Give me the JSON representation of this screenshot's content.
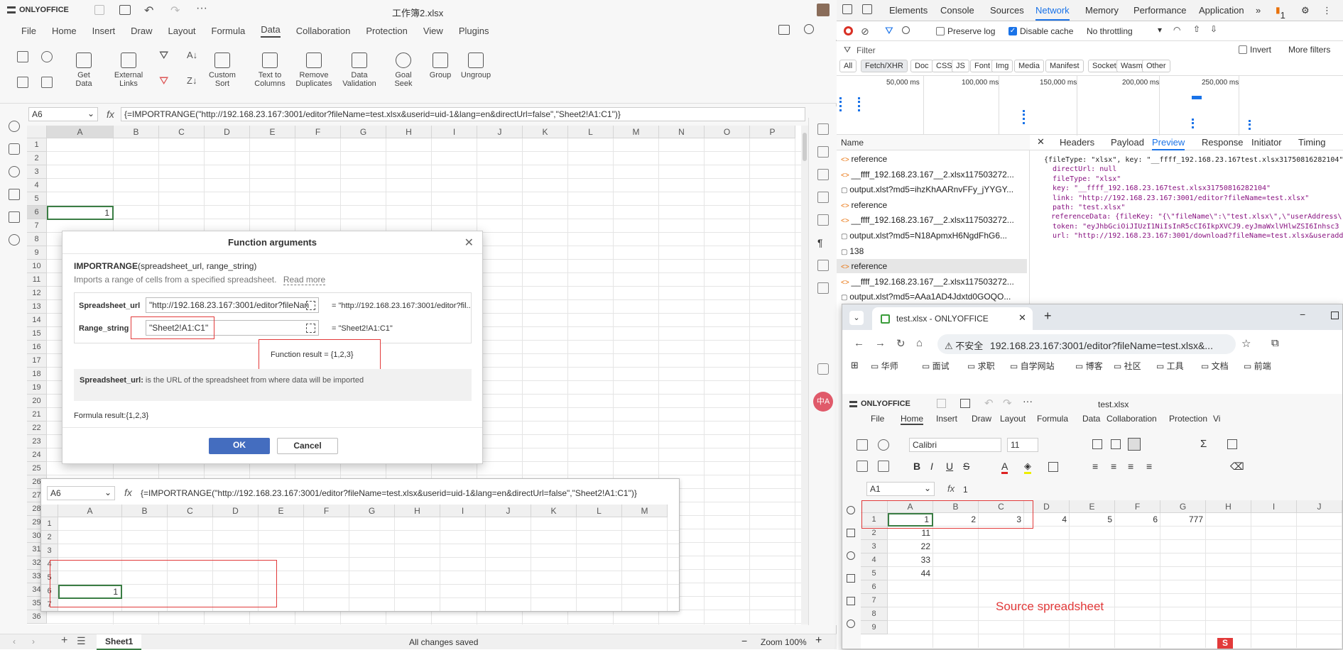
{
  "app": {
    "brand": "ONLYOFFICE",
    "title": "工作簿2.xlsx"
  },
  "menu": [
    "File",
    "Home",
    "Insert",
    "Draw",
    "Layout",
    "Formula",
    "Data",
    "Collaboration",
    "Protection",
    "View",
    "Plugins"
  ],
  "menu_active": "Data",
  "ribbon": [
    {
      "id": "get-data",
      "label": "Get\nData"
    },
    {
      "id": "external-links",
      "label": "External\nLinks"
    },
    {
      "id": "custom-sort",
      "label": "Custom\nSort"
    },
    {
      "id": "text-to-columns",
      "label": "Text to\nColumns"
    },
    {
      "id": "remove-duplicates",
      "label": "Remove\nDuplicates"
    },
    {
      "id": "data-validation",
      "label": "Data\nValidation"
    },
    {
      "id": "goal-seek",
      "label": "Goal\nSeek"
    },
    {
      "id": "group",
      "label": "Group"
    },
    {
      "id": "ungroup",
      "label": "Ungroup"
    }
  ],
  "formula_bar": {
    "cell": "A6",
    "fx": "fx",
    "formula": "{=IMPORTRANGE(\"http://192.168.23.167:3001/editor?fileName=test.xlsx&userid=uid-1&lang=en&directUrl=false\",\"Sheet2!A1:C1\")}"
  },
  "grid": {
    "columns": [
      "A",
      "B",
      "C",
      "D",
      "E",
      "F",
      "G",
      "H",
      "I",
      "J",
      "K",
      "L",
      "M",
      "N",
      "O",
      "P"
    ],
    "rows": [
      "1",
      "2",
      "3",
      "4",
      "5",
      "6",
      "7",
      "8",
      "9",
      "10",
      "11",
      "12",
      "13",
      "14",
      "15",
      "16",
      "17",
      "18",
      "19",
      "20",
      "21",
      "22",
      "23",
      "24",
      "25",
      "26",
      "27",
      "28",
      "29",
      "30",
      "31",
      "32",
      "33",
      "34",
      "35",
      "36"
    ],
    "a6_value": "1"
  },
  "dialog": {
    "title": "Function arguments",
    "func_name": "IMPORTRANGE",
    "func_sig": "(spreadsheet_url, range_string)",
    "desc": "Imports a range of cells from a specified spreadsheet.",
    "read_more": "Read more",
    "arg1_label": "Spreadsheet_url",
    "arg1_value": "\"http://192.168.23.167:3001/editor?fileNan",
    "arg1_result": "= \"http://192.168.23.167:3001/editor?fil...",
    "arg2_label": "Range_string",
    "arg2_value": "\"Sheet2!A1:C1\"",
    "arg2_result": "= \"Sheet2!A1:C1\"",
    "func_result_label": "Function result",
    "func_result_value": "= {1,2,3}",
    "help_label": "Spreadsheet_url:",
    "help_text": " is the URL of the spreadsheet from where data will be imported",
    "formula_result": "Formula result:{1,2,3}",
    "ok": "OK",
    "cancel": "Cancel"
  },
  "inner_view": {
    "cell": "A6",
    "formula": "{=IMPORTRANGE(\"http://192.168.23.167:3001/editor?fileName=test.xlsx&userid=uid-1&lang=en&directUrl=false\",\"Sheet2!A1:C1\")}",
    "columns": [
      "A",
      "B",
      "C",
      "D",
      "E",
      "F",
      "G",
      "H",
      "I",
      "J",
      "K",
      "L",
      "M"
    ],
    "rows": [
      "1",
      "2",
      "3",
      "4",
      "5",
      "6",
      "7"
    ],
    "a6_value": "1"
  },
  "statusbar": {
    "sheet": "Sheet1",
    "saved": "All changes saved",
    "zoom": "Zoom 100%"
  },
  "devtools": {
    "tabs": [
      "Elements",
      "Console",
      "Sources",
      "Network",
      "Memory",
      "Performance",
      "Application"
    ],
    "active": "Network",
    "issues": "1",
    "preserve_log": "Preserve log",
    "disable_cache": "Disable cache",
    "throttle": "No throttling",
    "filter_placeholder": "Filter",
    "invert": "Invert",
    "more_filters": "More filters",
    "chips": [
      "All",
      "Fetch/XHR",
      "Doc",
      "CSS",
      "JS",
      "Font",
      "Img",
      "Media",
      "Manifest",
      "Socket",
      "Wasm",
      "Other"
    ],
    "timeline": [
      "50,000 ms",
      "100,000 ms",
      "150,000 ms",
      "200,000 ms",
      "250,000 ms"
    ],
    "name_header": "Name",
    "requests": [
      "reference",
      "__ffff_192.168.23.167__2.xlsx117503272...",
      "output.xlst?md5=ihzKhAARnvFFy_jYYGY...",
      "reference",
      "__ffff_192.168.23.167__2.xlsx117503272...",
      "output.xlst?md5=N18ApmxH6NgdFhG6...",
      "138",
      "reference",
      "__ffff_192.168.23.167__2.xlsx117503272...",
      "output.xlst?md5=AAa1AD4Jdxtd0GOQO..."
    ],
    "detail_tabs": [
      "Headers",
      "Payload",
      "Preview",
      "Response",
      "Initiator",
      "Timing"
    ],
    "detail_active": "Preview",
    "preview_lines": [
      "{fileType: \"xlsx\", key: \"__ffff_192.168.23.167test.xlsx31750816282104\"",
      "directUrl: null",
      "fileType: \"xlsx\"",
      "key: \"__ffff_192.168.23.167test.xlsx31750816282104\"",
      "link: \"http://192.168.23.167:3001/editor?fileName=test.xlsx\"",
      "path: \"test.xlsx\"",
      "referenceData: {fileKey: \"{\\\"fileName\\\":\\\"test.xlsx\\\",\\\"userAddress\\\":\\\"_",
      "token: \"eyJhbGciOiJIUzI1NiIsInR5cCI6IkpXVCJ9.eyJmaWxlVHlwZSI6Inhsc3",
      "url: \"http://192.168.23.167:3001/download?fileName=test.xlsx&useradd"
    ]
  },
  "chrome": {
    "tab_title": "test.xlsx - ONLYOFFICE",
    "insecure": "不安全",
    "url": "192.168.23.167:3001/editor?fileName=test.xlsx&...",
    "bookmarks": [
      "华师",
      "面试",
      "求职",
      "自学网站",
      "博客",
      "社区",
      "工具",
      "文档",
      "前端"
    ],
    "app_title": "test.xlsx",
    "menu": [
      "File",
      "Home",
      "Insert",
      "Draw",
      "Layout",
      "Formula",
      "Data",
      "Collaboration",
      "Protection",
      "Vi"
    ],
    "menu_active": "Home",
    "font": "Calibri",
    "font_size": "11",
    "cell": "A1",
    "formula": "1",
    "columns": [
      "A",
      "B",
      "C",
      "D",
      "E",
      "F",
      "G",
      "H",
      "I",
      "J"
    ],
    "rows": [
      "1",
      "2",
      "3",
      "4",
      "5",
      "6",
      "7",
      "8",
      "9"
    ],
    "row1": [
      "1",
      "2",
      "3",
      "4",
      "5",
      "6",
      "777"
    ],
    "colA": [
      "11",
      "22",
      "33",
      "44"
    ],
    "annotation": "Source spreadsheet"
  }
}
